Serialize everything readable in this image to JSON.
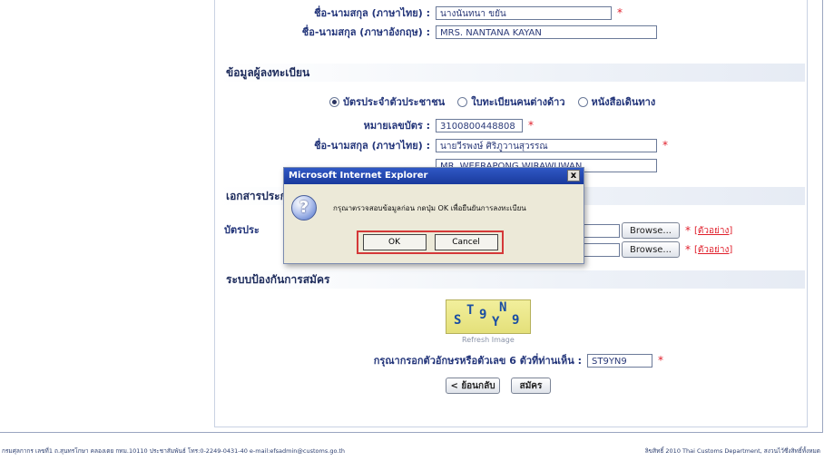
{
  "form": {
    "name_th_label": "ชื่อ-นามสกุล (ภาษาไทย) :",
    "name_th_value": "นางนันทนา ขยัน",
    "name_en_label": "ชื่อ-นามสกุล (ภาษาอังกฤษ) :",
    "name_en_value": "MRS. NANTANA KAYAN",
    "reg_section_title": "ข้อมูลผู้ลงทะเบียน",
    "doc_types": [
      "บัตรประจำตัวประชาชน",
      "ใบทะเบียนคนต่างด้าว",
      "หนังสือเดินทาง"
    ],
    "doc_selected": 0,
    "card_no_label": "หมายเลขบัตร :",
    "card_no_value": "3100800448808",
    "reg_name_th_label": "ชื่อ-นามสกุล (ภาษาไทย) :",
    "reg_name_th_value": "นายวีรพงษ์ ศิริภูวานสุวรรณ",
    "reg_name_en_value": "MR. WEERAPONG WIRAWUWAN",
    "docs_section_title": "เอกสารประกอบ",
    "doc_row_label": "บัตรประ",
    "browse_label": "Browse...",
    "example_link": "[ตัวอย่าง]",
    "protect_section_title": "ระบบป้องกันการสมัคร",
    "captcha_text": "ST9YN9",
    "refresh_label": "Refresh Image",
    "captcha_prompt": "กรุณากรอกตัวอักษรหรือตัวเลข 6 ตัวที่ท่านเห็น :",
    "captcha_input": "ST9YN9",
    "back_button": "< ย้อนกลับ",
    "submit_button": "สมัคร",
    "required_mark": "*"
  },
  "dialog": {
    "title": "Microsoft Internet Explorer",
    "close": "x",
    "message": "กรุณาตรวจสอบข้อมูลก่อน กดปุ่ม OK เพื่อยืนยันการลงทะเบียน",
    "ok": "OK",
    "cancel": "Cancel",
    "icon": "question-icon"
  },
  "footer": {
    "left": "กรมศุลกากร เลขที่1 ถ.สุนทรโกษา คลองเตย กทม.10110 ประชาสัมพันธ์ โทร:0-2249-0431-40 e-mail:efsadmin@customs.go.th",
    "right": "ลิขสิทธิ์ 2010 Thai Customs Department, สงวนไว้ซึ่งสิทธิ์ทั้งหมด"
  },
  "colors": {
    "required": "#e0202c",
    "label": "#23357a",
    "dialog_title": "#1a3a9c"
  }
}
